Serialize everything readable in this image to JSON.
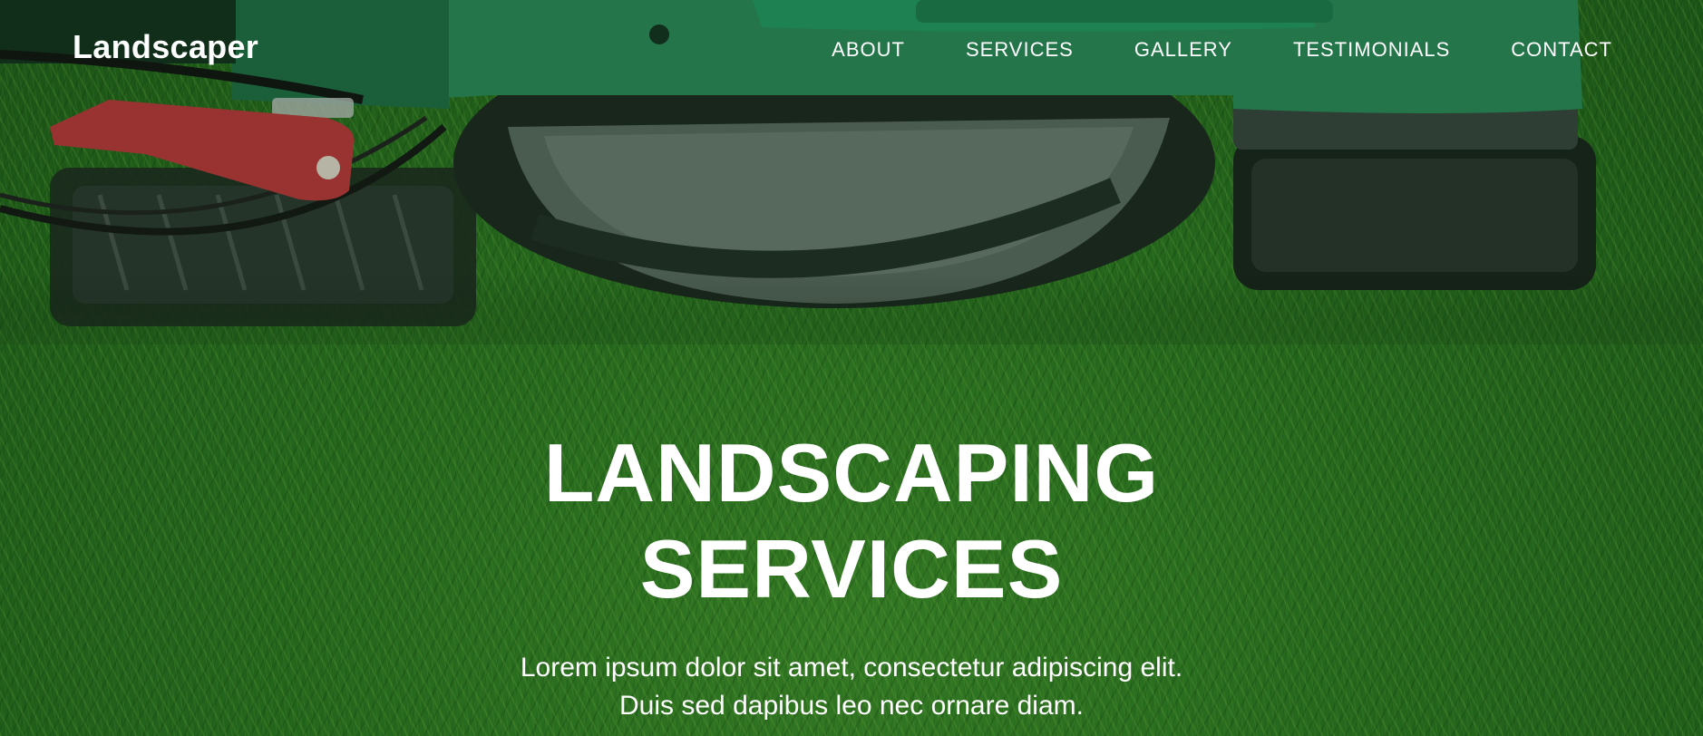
{
  "brand": {
    "name": "Landscaper"
  },
  "nav": {
    "items": [
      {
        "label": "ABOUT"
      },
      {
        "label": "SERVICES"
      },
      {
        "label": "GALLERY"
      },
      {
        "label": "TESTIMONIALS"
      },
      {
        "label": "CONTACT"
      }
    ]
  },
  "hero": {
    "title_line1": "LANDSCAPING",
    "title_line2": "SERVICES",
    "subtitle_line1": "Lorem ipsum dolor sit amet, consectetur adipiscing elit.",
    "subtitle_line2": "Duis sed dapibus leo nec ornare diam."
  },
  "colors": {
    "text": "#ffffff",
    "grass": "#2e7a22",
    "mower_body": "#2f8a5a",
    "lever": "#c0343a"
  }
}
